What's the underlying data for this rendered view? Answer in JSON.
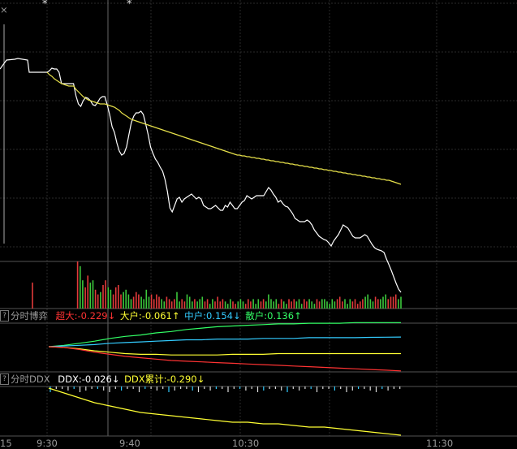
{
  "colors": {
    "background": "#000000",
    "grid": "#2a2a2a",
    "border": "#555555",
    "price_line": "#ffffff",
    "avg_line": "#e6e04a",
    "up_bar": "#3cc83c",
    "down_bar": "#e23a3a",
    "chaoda": "#ff3333",
    "dahu": "#ffff33",
    "zhonghu": "#33ccff",
    "sanhu": "#33ff66",
    "ddx": "#ffffff",
    "ddx_cum": "#ffff33"
  },
  "top_marks": {
    "close": "×",
    "star1": "*",
    "star2": "*"
  },
  "boyi_panel": {
    "question_icon": "?",
    "title": "分时博弈",
    "chaoda": "超大:-0.229↓",
    "dahu": "大户:-0.061↑",
    "zhonghu": "中户:0.154↓",
    "sanhu": "散户:0.136↑"
  },
  "ddx_panel": {
    "question_icon": "?",
    "title": "分时DDX",
    "ddx": "DDX:-0.026↓",
    "ddx_cum": "DDX累计:-0.290↓"
  },
  "time_axis": [
    "15",
    "9:30",
    "9:40",
    "10:30",
    "11:30"
  ],
  "chart_data": [
    {
      "type": "line",
      "panel": "price",
      "series": [
        {
          "name": "price",
          "values": [
            58,
            56,
            53,
            54,
            54,
            58,
            72,
            72,
            72,
            72,
            72,
            72,
            87,
            97,
            100,
            93,
            89,
            90,
            93,
            98,
            99,
            95,
            90,
            88,
            88,
            98,
            110,
            125,
            132,
            145,
            155,
            160,
            158,
            150,
            135,
            120,
            112,
            108,
            108,
            106,
            110,
            122,
            135,
            150,
            158,
            165,
            169,
            175,
            180,
            190,
            205,
            225,
            230,
            222,
            214,
            212,
            218,
            214,
            212,
            210,
            208,
            211,
            214,
            212,
            214,
            222,
            224,
            226,
            226,
            224,
            222,
            225,
            228,
            228,
            222,
            224,
            218,
            222,
            226,
            226,
            222,
            218,
            216,
            210,
            212,
            214,
            212,
            210,
            210,
            210,
            210,
            205,
            200,
            203,
            208,
            212,
            218,
            216,
            220,
            223,
            224,
            228,
            232,
            238,
            240,
            242,
            242,
            242,
            240,
            242,
            246,
            252,
            256,
            260,
            262,
            264,
            265,
            268,
            272,
            266,
            262,
            258,
            252,
            246,
            248,
            250,
            255,
            260,
            262,
            262,
            262,
            260,
            258,
            260,
            265,
            270,
            274,
            276,
            277,
            278,
            280,
            288,
            295,
            302,
            310,
            318,
            325,
            329
          ]
        },
        {
          "name": "avg",
          "values": [
            58,
            61,
            63,
            66,
            68,
            70,
            72,
            73,
            74,
            75,
            75,
            75,
            79,
            82,
            85,
            88,
            90,
            92,
            93,
            94,
            95,
            96,
            97,
            97,
            97,
            98,
            99,
            100,
            101,
            103,
            105,
            108,
            110,
            112,
            114,
            116,
            117,
            118,
            119,
            120,
            121,
            122,
            123,
            124,
            125,
            126,
            127,
            128,
            129,
            130,
            131,
            132,
            133,
            134,
            135,
            136,
            137,
            138,
            139,
            140,
            141,
            142,
            143,
            144,
            145,
            146,
            147,
            148,
            149,
            150,
            151,
            152,
            153,
            154,
            155,
            156,
            157,
            158,
            159,
            160,
            160,
            161,
            161,
            162,
            162,
            163,
            163,
            164,
            164,
            165,
            165,
            166,
            166,
            167,
            167,
            168,
            168,
            169,
            169,
            170,
            170,
            171,
            171,
            172,
            172,
            173,
            173,
            174,
            174,
            175,
            175,
            176,
            176,
            177,
            177,
            178,
            178,
            179,
            179,
            180,
            180,
            181,
            181,
            182,
            182,
            183,
            183,
            184,
            184,
            185,
            185,
            186,
            186,
            187,
            187,
            188,
            188,
            189,
            189,
            190,
            190,
            191,
            191,
            192,
            193,
            194,
            195,
            196
          ]
        }
      ]
    },
    {
      "type": "bar",
      "panel": "volume",
      "values": [
        0.55,
        0,
        0,
        0,
        0,
        0,
        0,
        0,
        0,
        0,
        0,
        0,
        1.0,
        0.9,
        0.6,
        0.45,
        0.7,
        0.55,
        0.6,
        0.4,
        0.3,
        0.35,
        0.5,
        0.6,
        0.45,
        0.4,
        0.3,
        0.45,
        0.5,
        0.3,
        0.35,
        0.4,
        0.3,
        0.2,
        0.25,
        0.35,
        0.3,
        0.25,
        0.2,
        0.4,
        0.25,
        0.3,
        0.2,
        0.3,
        0.25,
        0.2,
        0.15,
        0.25,
        0.2,
        0.15,
        0.2,
        0.35,
        0.15,
        0.2,
        0.15,
        0.3,
        0.25,
        0.15,
        0.2,
        0.15,
        0.2,
        0.25,
        0.15,
        0.2,
        0.1,
        0.2,
        0.15,
        0.25,
        0.15,
        0.2,
        0.15,
        0.1,
        0.2,
        0.15,
        0.1,
        0.15,
        0.2,
        0.15,
        0.1,
        0.2,
        0.15,
        0.2,
        0.1,
        0.2,
        0.15,
        0.2,
        0.15,
        0.3,
        0.2,
        0.15,
        0.2,
        0.1,
        0.2,
        0.15,
        0.1,
        0.2,
        0.15,
        0.2,
        0.15,
        0.2,
        0.1,
        0.2,
        0.15,
        0.2,
        0.15,
        0.1,
        0.2,
        0.15,
        0.2,
        0.2,
        0.15,
        0.1,
        0.2,
        0.15,
        0.2,
        0.25,
        0.15,
        0.2,
        0.1,
        0.2,
        0.15,
        0.2,
        0.1,
        0.15,
        0.2,
        0.25,
        0.3,
        0.2,
        0.15,
        0.25,
        0.2,
        0.2,
        0.25,
        0.3,
        0.2,
        0.25,
        0.25,
        0.3,
        0.2,
        0.25
      ],
      "directions": "dduudddduuuuduudduuddudduudddduuuuddduuuudddduudddduudduuuduuudduudddduuudduuuddduuudduuuuudduuddduuudduuudduuuuuuddduuuddddduuuudduuudddduu"
    },
    {
      "type": "line",
      "panel": "boyi",
      "series": [
        {
          "name": "超大",
          "values": [
            0,
            0.2,
            0.5,
            0.8,
            1.2,
            1.5,
            1.7,
            2.0,
            2.2,
            2.5,
            2.7,
            2.9,
            3.0,
            3.1,
            3.2,
            3.3,
            3.3,
            3.4,
            3.4,
            3.4,
            3.5,
            3.5,
            3.5,
            3.5
          ]
        },
        {
          "name": "大户",
          "values": [
            0,
            0.1,
            0.2,
            0.3,
            0.5,
            0.6,
            0.7,
            0.8,
            0.9,
            1.0,
            1.0,
            1.1,
            1.1,
            1.1,
            1.2,
            1.2,
            1.2,
            1.3,
            1.3,
            1.3,
            1.3,
            1.35,
            1.38,
            1.4
          ]
        },
        {
          "name": "中户",
          "values": [
            0,
            -0.1,
            -0.3,
            -0.6,
            -0.8,
            -1.0,
            -1.1,
            -1.1,
            -1.2,
            -1.2,
            -1.2,
            -1.2,
            -1.1,
            -1.1,
            -1.1,
            -1.0,
            -1.0,
            -1.0,
            -1.0,
            -1.0,
            -1.0,
            -1.0,
            -1.0,
            -1.0
          ]
        },
        {
          "name": "散户",
          "values": [
            0,
            -0.1,
            -0.4,
            -0.8,
            -1.1,
            -1.4,
            -1.6,
            -1.8,
            -2.0,
            -2.1,
            -2.2,
            -2.3,
            -2.4,
            -2.5,
            -2.6,
            -2.7,
            -2.8,
            -2.9,
            -3.0,
            -3.1,
            -3.2,
            -3.3,
            -3.4,
            -3.5
          ]
        }
      ]
    },
    {
      "type": "line",
      "panel": "ddx",
      "series": [
        {
          "name": "DDX累计",
          "values": [
            0,
            0.03,
            0.06,
            0.09,
            0.11,
            0.13,
            0.15,
            0.16,
            0.17,
            0.18,
            0.19,
            0.2,
            0.21,
            0.21,
            0.22,
            0.22,
            0.23,
            0.24,
            0.24,
            0.25,
            0.26,
            0.27,
            0.28,
            0.29
          ]
        }
      ]
    }
  ]
}
